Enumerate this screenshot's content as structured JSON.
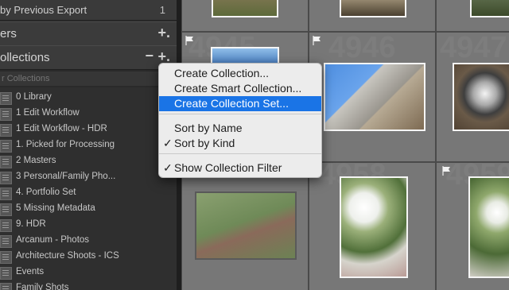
{
  "left_panel": {
    "export_row": {
      "label": "by Previous Export",
      "count": "1"
    },
    "section_filters": {
      "title": "ers",
      "add": "+."
    },
    "section_collections": {
      "title": "ollections",
      "minus": "−",
      "add": "+."
    },
    "filter_placeholder": "r Collections",
    "collections": [
      {
        "label": "0 Library"
      },
      {
        "label": "1 Edit Workflow"
      },
      {
        "label": "1 Edit Workflow - HDR"
      },
      {
        "label": "1. Picked for Processing"
      },
      {
        "label": "2 Masters"
      },
      {
        "label": "3 Personal/Family Pho..."
      },
      {
        "label": "4. Portfolio Set"
      },
      {
        "label": "5 Missing Metadata"
      },
      {
        "label": "9. HDR"
      },
      {
        "label": "Arcanum - Photos"
      },
      {
        "label": "Architecture Shoots - ICS"
      },
      {
        "label": "Events"
      },
      {
        "label": "Family Shots"
      }
    ]
  },
  "grid": {
    "cells": [
      {
        "number": "4945"
      },
      {
        "number": "4946"
      },
      {
        "number": "4947"
      },
      {
        "number": "4958"
      },
      {
        "number": "4959"
      }
    ]
  },
  "context_menu": {
    "items": [
      {
        "label": "Create Collection...",
        "checked": false,
        "selected": false
      },
      {
        "label": "Create Smart Collection...",
        "checked": false,
        "selected": false
      },
      {
        "label": "Create Collection Set...",
        "checked": false,
        "selected": true
      },
      {
        "label": "Sort by Name",
        "checked": false,
        "selected": false
      },
      {
        "label": "Sort by Kind",
        "checked": true,
        "selected": false
      },
      {
        "label": "Show Collection Filter",
        "checked": true,
        "selected": false
      }
    ],
    "check_glyph": "✓"
  },
  "colors": {
    "menu_highlight": "#1a74e6",
    "panel_bg": "#2f2f2f",
    "grid_bg": "#595959"
  }
}
